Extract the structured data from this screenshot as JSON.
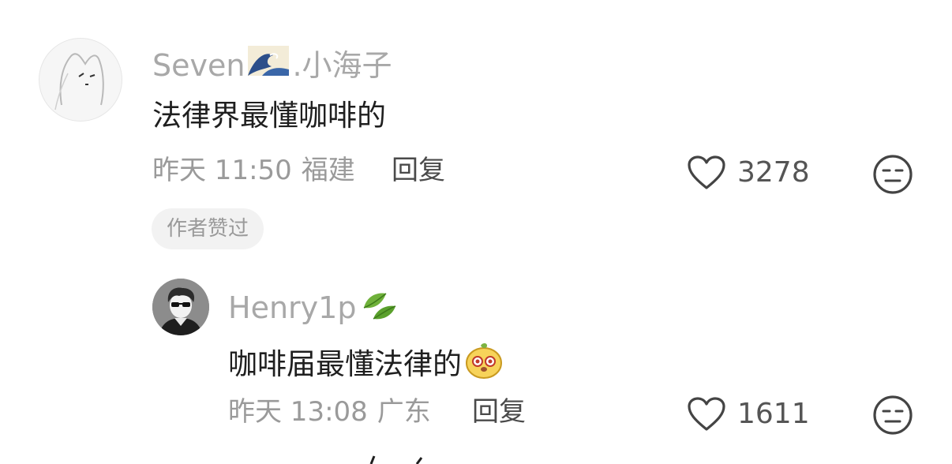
{
  "comments": [
    {
      "username": "Seven",
      "username_suffix": ".小海子",
      "username_emoji": "wave-emoji",
      "text": "法律界最懂咖啡的",
      "time": "昨天 11:50",
      "location": "福建",
      "reply_label": "回复",
      "likes": "3278",
      "badge": "作者赞过",
      "avatar": "sketch-cat-avatar"
    },
    {
      "username": "Henry1p",
      "username_emoji": "leaf-emoji",
      "text": "咖啡届最懂法律的",
      "text_emoji": "cute-face-emoji",
      "time": "昨天 13:08",
      "location": "广东",
      "reply_label": "回复",
      "likes": "1611",
      "avatar": "sunglasses-boy-avatar"
    }
  ],
  "icons": {
    "like": "heart-outline-icon",
    "react": "meh-face-icon"
  },
  "colors": {
    "username": "#a8a8a8",
    "text": "#1f1f1f",
    "meta": "#9a9a9a",
    "badge_bg": "#f2f2f2"
  }
}
